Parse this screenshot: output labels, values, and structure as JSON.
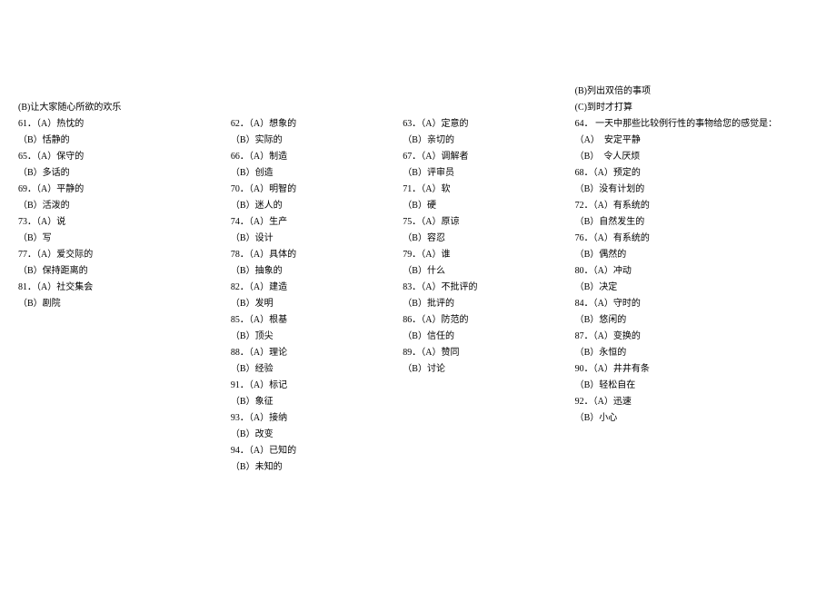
{
  "col1": {
    "header_b": "(B)让大家随心所欲的欢乐",
    "q61_a": "61．（A）热忱的",
    "q61_b": "（B）恬静的",
    "q65_a": "65．（A）保守的",
    "q65_b": "（B）多话的",
    "q69_a": "69．（A）平静的",
    "q69_b": "（B）活泼的",
    "q73_a": "73．（A）说",
    "q73_b": "（B）写",
    "q77_a": "77．（A）爱交际的",
    "q77_b": "（B）保持距离的",
    "q81_a": "81．（A）社交集会",
    "q81_b": "（B）剧院"
  },
  "col2": {
    "q62_a": "62．（A）想象的",
    "q62_b": "（B）实际的",
    "q66_a": "66．（A）制造",
    "q66_b": "（B）创造",
    "q70_a": "70．（A）明智的",
    "q70_b": "（B）迷人的",
    "q74_a": "74．（A）生产",
    "q74_b": "（B）设计",
    "q78_a": "78．（A）具体的",
    "q78_b": "（B）抽象的",
    "q82_a": "82．（A）建造",
    "q82_b": "（B）发明",
    "q85_a": "85．（A）根基",
    "q85_b": "（B）顶尖",
    "q88_a": "88．（A）理论",
    "q88_b": "（B）经验",
    "q91_a": "91．（A）标记",
    "q91_b": "（B）象征",
    "q93_a": "93．（A）接纳",
    "q93_b": "（B）改变",
    "q94_a": "94．（A）已知的",
    "q94_b": "（B）未知的"
  },
  "col3": {
    "q63_a": "63．（A）定意的",
    "q63_b": "（B）亲切的",
    "q67_a": "67．（A）调解者",
    "q67_b": "（B）评审员",
    "q71_a": "71．（A）软",
    "q71_b": "（B）硬",
    "q75_a": "75．（A）原谅",
    "q75_b": "（B）容忍",
    "q79_a": "79．（A）谁",
    "q79_b": "（B）什么",
    "q83_a": "83．（A）不批评的",
    "q83_b": "（B）批评的",
    "q86_a": "86．（A）防范的",
    "q86_b": "（B）信任的",
    "q89_a": "89．（A）赞同",
    "q89_b": "（B）讨论"
  },
  "col4": {
    "header_b": "(B)列出双倍的事项",
    "header_c": "(C)到时才打算",
    "q64_q": "64． 一天中那些比较例行性的事物给您的感觉是：",
    "q64_a": "（A）　安定平静",
    "q64_b": "（B）　令人厌烦",
    "q68_a": "68．（A）预定的",
    "q68_b": "（B）没有计划的",
    "q72_a": "72．（A）有系统的",
    "q72_b": "（B）自然发生的",
    "q76_a": "76．（A）有系统的",
    "q76_b": "（B）偶然的",
    "q80_a": "80．（A）冲动",
    "q80_b": "（B）决定",
    "q84_a": "84．（A）守时的",
    "q84_b": "（B）悠闲的",
    "q87_a": "87．（A）变换的",
    "q87_b": "（B）永恒的",
    "q90_a": "90．（A）井井有条",
    "q90_b": "（B）轻松自在",
    "q92_a": "92．（A）迅速",
    "q92_b": "（B）小心"
  }
}
